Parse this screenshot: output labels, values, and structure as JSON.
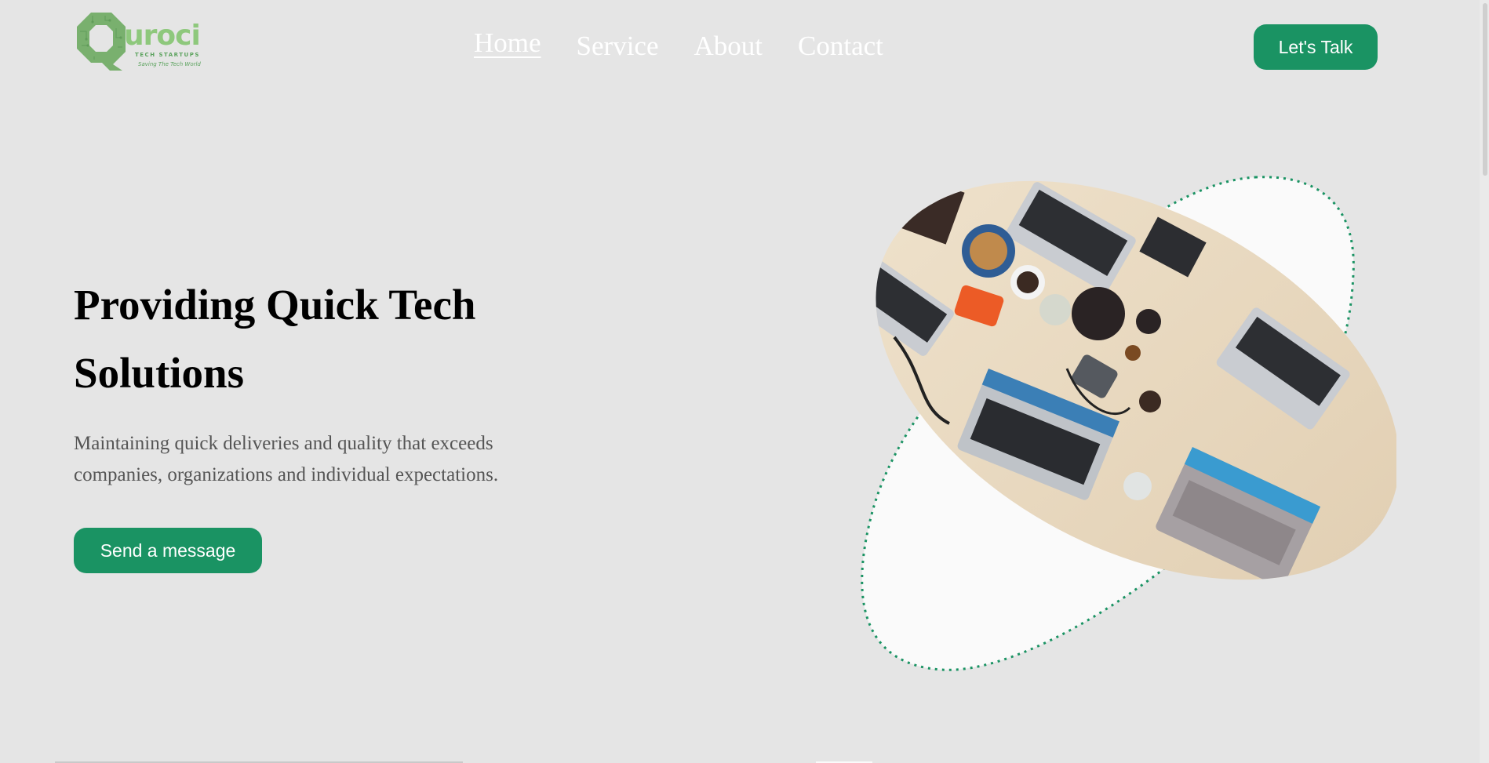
{
  "logo": {
    "wordmark": "uroci",
    "subtitle": "TECH STARTUPS",
    "tagline": "Saving The Tech World",
    "icon": "octagon-q-logo",
    "color": "#8ec87c"
  },
  "nav": {
    "items": [
      {
        "label": "Home",
        "active": true
      },
      {
        "label": "Service",
        "active": false
      },
      {
        "label": "About",
        "active": false
      },
      {
        "label": "Contact",
        "active": false
      }
    ]
  },
  "header": {
    "cta_label": "Let's Talk"
  },
  "hero": {
    "title": "Providing Quick Tech Solutions",
    "description": "Maintaining quick deliveries and quality that exceeds companies, organizations and individual expectations.",
    "button_label": "Send a message",
    "image": "workspace-desk-laptops-photo"
  },
  "colors": {
    "background": "#e5e5e5",
    "accent": "#1a9363",
    "nav_text": "#ffffff",
    "blob": "#fafafa"
  }
}
